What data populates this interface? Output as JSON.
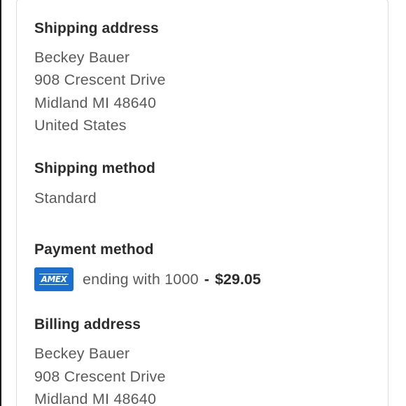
{
  "shipping_address": {
    "title": "Shipping address",
    "lines": [
      "Beckey Bauer",
      "908 Crescent Drive",
      "Midland MI 48640",
      "United States"
    ]
  },
  "shipping_method": {
    "title": "Shipping method",
    "value": "Standard"
  },
  "payment_method": {
    "title": "Payment method",
    "card_brand": "AMEX",
    "card_icon": "amex-card-icon",
    "card_color": "#1a6fd0",
    "ending_text": "ending with 1000",
    "separator": "-",
    "amount": "$29.05"
  },
  "billing_address": {
    "title": "Billing address",
    "lines": [
      "Beckey Bauer",
      "908 Crescent Drive",
      "Midland MI 48640"
    ]
  }
}
